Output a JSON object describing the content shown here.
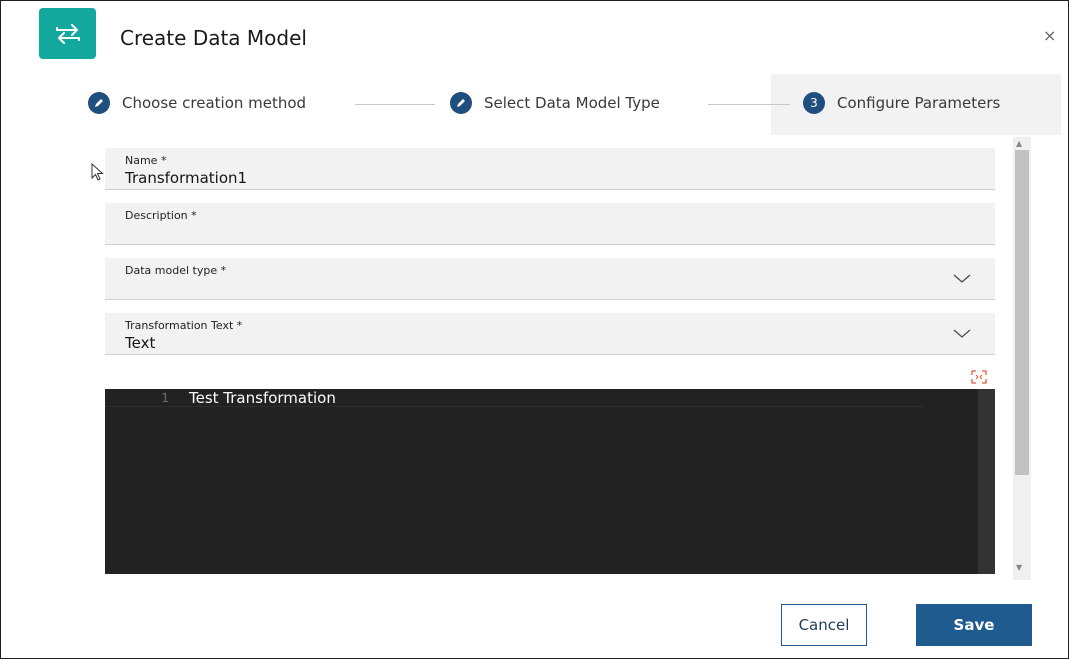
{
  "dialog": {
    "title": "Create Data Model",
    "close_glyph": "×",
    "app_icon": "transform-arrows-icon"
  },
  "steps": [
    {
      "label": "Choose creation method",
      "status": "complete",
      "icon": "pencil-icon"
    },
    {
      "label": "Select Data Model Type",
      "status": "complete",
      "icon": "pencil-icon"
    },
    {
      "label": "Configure Parameters",
      "status": "current",
      "number": "3"
    }
  ],
  "form": {
    "name": {
      "label": "Name *",
      "value": "Transformation1"
    },
    "description": {
      "label": "Description *",
      "value": ""
    },
    "data_model_type": {
      "label": "Data model type *",
      "value": ""
    },
    "transformation_text": {
      "label": "Transformation Text *",
      "value": "Text"
    }
  },
  "editor": {
    "lines": [
      {
        "number": "1",
        "text": "Test Transformation"
      }
    ]
  },
  "buttons": {
    "cancel": "Cancel",
    "save": "Save"
  },
  "colors": {
    "accent": "#13a89e",
    "primary": "#1f5b8f",
    "step_icon": "#1f4f7f",
    "editor_bg": "#222222"
  }
}
